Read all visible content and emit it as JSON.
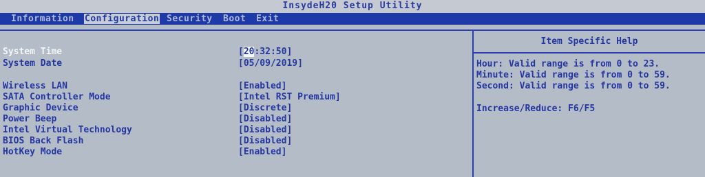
{
  "window": {
    "title": "InsydeH20 Setup Utility"
  },
  "menu": [
    {
      "label": "Information"
    },
    {
      "label": "Configuration"
    },
    {
      "label": "Security"
    },
    {
      "label": "Boot"
    },
    {
      "label": "Exit"
    }
  ],
  "time": {
    "label": "System Time",
    "hour": "20",
    "rest": ":32:50]"
  },
  "settings": [
    {
      "label": "System Date",
      "value": "[05/09/2019]"
    },
    {
      "label": "Wireless LAN",
      "value": "[Enabled]"
    },
    {
      "label": "SATA Controller Mode",
      "value": "[Intel RST Premium]"
    },
    {
      "label": "Graphic Device",
      "value": "[Discrete]"
    },
    {
      "label": "Power Beep",
      "value": "[Disabled]"
    },
    {
      "label": "Intel Virtual Technology",
      "value": "[Disabled]"
    },
    {
      "label": "BIOS Back Flash",
      "value": "[Disabled]"
    },
    {
      "label": "HotKey Mode",
      "value": "[Enabled]"
    }
  ],
  "help": {
    "title": "Item Specific Help",
    "lines": [
      "Hour: Valid range is from 0 to 23.",
      "Minute: Valid range is from 0 to 59.",
      "Second: Valid range is from 0 to 59.",
      "Increase/Reduce: F6/F5"
    ]
  }
}
